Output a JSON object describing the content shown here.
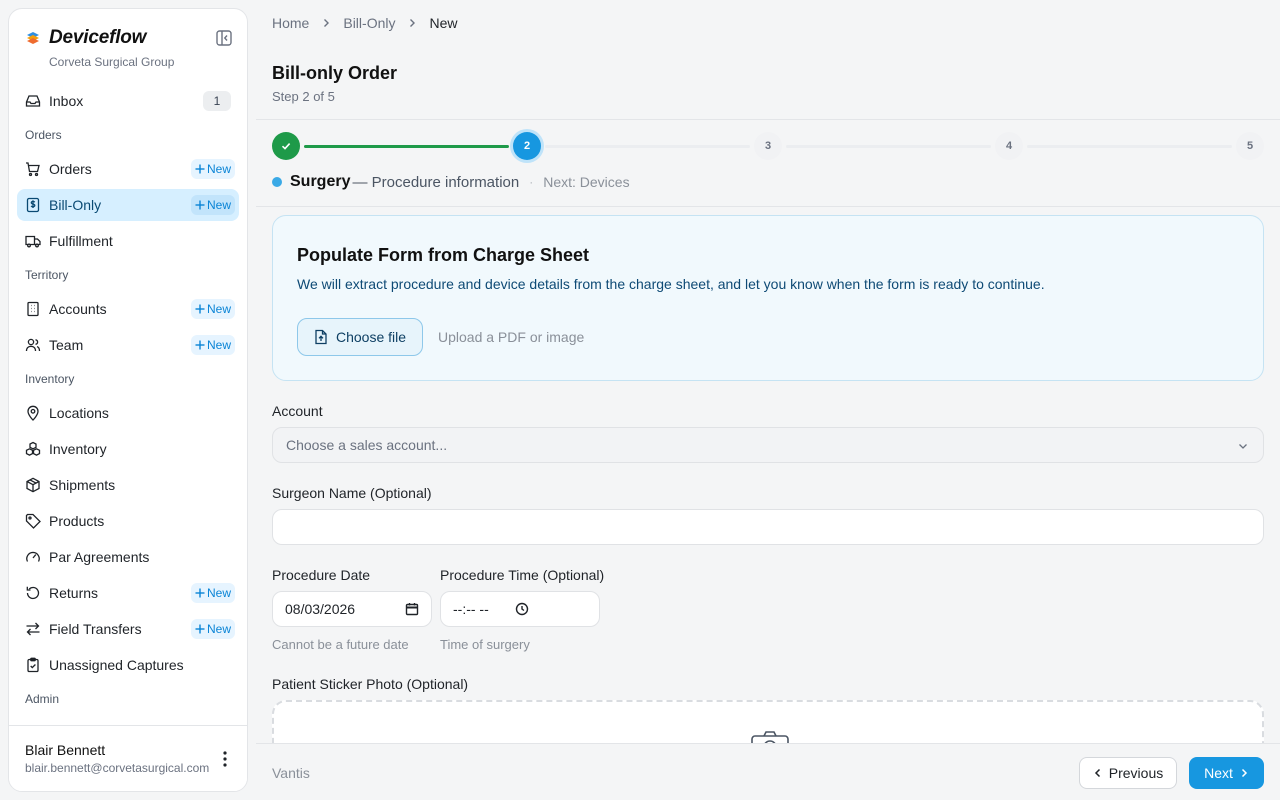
{
  "colors": {
    "accent": "#1797e0",
    "success": "#1e9a49",
    "active_nav_bg": "#d6efff",
    "new_badge": "#0a84d6"
  },
  "brand": {
    "name": "Deviceflow",
    "org": "Corveta Surgical Group"
  },
  "sidebar": {
    "inbox": {
      "label": "Inbox",
      "count": "1"
    },
    "sections": {
      "orders": "Orders",
      "territory": "Territory",
      "inventory": "Inventory",
      "admin": "Admin"
    },
    "new_label": "New",
    "items": {
      "orders": "Orders",
      "bill_only": "Bill-Only",
      "fulfillment": "Fulfillment",
      "accounts": "Accounts",
      "team": "Team",
      "locations": "Locations",
      "inventory": "Inventory",
      "shipments": "Shipments",
      "products": "Products",
      "par_agreements": "Par Agreements",
      "returns": "Returns",
      "field_transfers": "Field Transfers",
      "unassigned_captures": "Unassigned Captures"
    },
    "active_item": "bill_only"
  },
  "user": {
    "name": "Blair Bennett",
    "email": "blair.bennett@corvetasurgical.com"
  },
  "breadcrumb": [
    "Home",
    "Bill-Only",
    "New"
  ],
  "page": {
    "title": "Bill-only Order",
    "step_text": "Step 2 of 5"
  },
  "stepper": {
    "current": 2,
    "total": 5,
    "labels": [
      "",
      "2",
      "3",
      "4",
      "5"
    ],
    "caption": {
      "name": "Surgery",
      "desc": "— Procedure information",
      "sep": "·",
      "next": "Next: Devices"
    }
  },
  "charge_sheet": {
    "title": "Populate Form from Charge Sheet",
    "description": "We will extract procedure and device details from the charge sheet, and let you know when the form is ready to continue.",
    "button": "Choose file",
    "hint": "Upload a PDF or image"
  },
  "form": {
    "account": {
      "label": "Account",
      "placeholder": "Choose a sales account..."
    },
    "surgeon": {
      "label": "Surgeon Name (Optional)",
      "value": ""
    },
    "procedure_date": {
      "label": "Procedure Date",
      "value": "08/03/2026",
      "hint": "Cannot be a future date"
    },
    "procedure_time": {
      "label": "Procedure Time (Optional)",
      "value": "--:-- --",
      "hint": "Time of surgery"
    },
    "patient_sticker": {
      "label": "Patient Sticker Photo (Optional)"
    }
  },
  "footer": {
    "brand": "Vantis",
    "previous": "Previous",
    "next": "Next"
  }
}
